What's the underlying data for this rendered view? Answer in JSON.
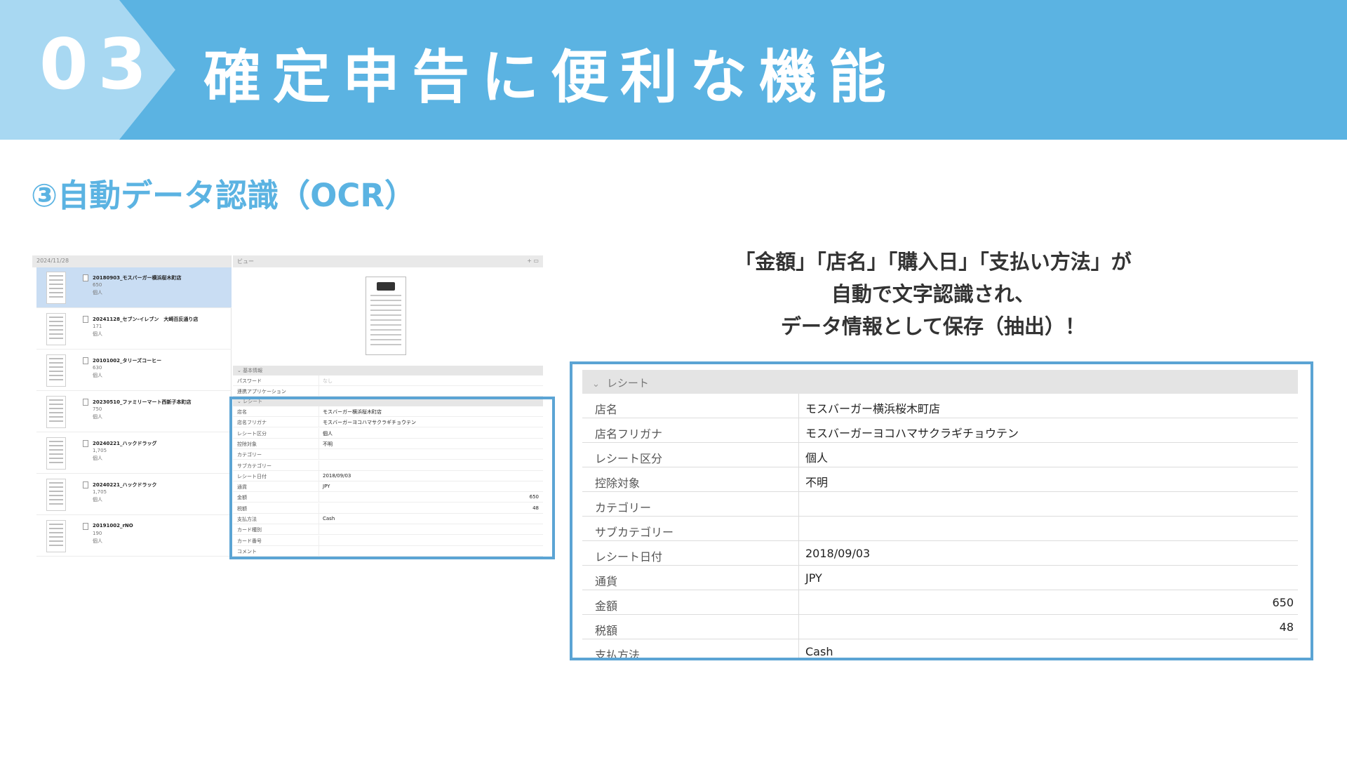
{
  "header": {
    "number": "03",
    "title": "確定申告に便利な機能",
    "colors": {
      "band": "#5bb3e2",
      "chevron": "#a8d8f2",
      "text": "#ffffff"
    }
  },
  "subtitle": "③自動データ認識（OCR）",
  "caption": {
    "lines": [
      "「金額」「店名」「購入日」「支払い方法」が",
      "自動で文字認識され、",
      "データ情報として保存（抽出）！"
    ]
  },
  "list": {
    "date_header": "2024/11/28",
    "items": [
      {
        "title": "20180903_モスバーガー横浜桜木町店",
        "amount": "650",
        "category": "個人",
        "selected": true
      },
      {
        "title": "20241128_セブン-イレブン　大崎百反通り店",
        "amount": "171",
        "category": "個人",
        "selected": false
      },
      {
        "title": "20101002_タリーズコーヒー",
        "amount": "630",
        "category": "個人",
        "selected": false
      },
      {
        "title": "20230510_ファミリーマート西新子本町店",
        "amount": "750",
        "category": "個人",
        "selected": false
      },
      {
        "title": "20240221_ハックドラッグ",
        "amount": "1,705",
        "category": "個人",
        "selected": false
      },
      {
        "title": "20240221_ハックドラック",
        "amount": "1,705",
        "category": "個人",
        "selected": false
      },
      {
        "title": "20191002_rNO",
        "amount": "190",
        "category": "個人",
        "selected": false
      }
    ]
  },
  "detail": {
    "view_label": "ビュー",
    "view_controls": "+ ▭",
    "basic_section": "基本情報",
    "basic_rows": [
      {
        "label": "パスワード",
        "value": "なし"
      },
      {
        "label": "連携アプリケーション",
        "value": ""
      }
    ],
    "receipt_section": "レシート",
    "extra_rows": [
      {
        "label": "カード種別",
        "value": ""
      },
      {
        "label": "カード番号",
        "value": ""
      },
      {
        "label": "コメント",
        "value": ""
      }
    ]
  },
  "receipt": {
    "section_label": "レシート",
    "rows": [
      {
        "label": "店名",
        "value": "モスバーガー横浜桜木町店",
        "numeric": false
      },
      {
        "label": "店名フリガナ",
        "value": "モスバーガーヨコハマサクラギチョウテン",
        "numeric": false
      },
      {
        "label": "レシート区分",
        "value": "個人",
        "numeric": false
      },
      {
        "label": "控除対象",
        "value": "不明",
        "numeric": false
      },
      {
        "label": "カテゴリー",
        "value": "",
        "numeric": false
      },
      {
        "label": "サブカテゴリー",
        "value": "",
        "numeric": false
      },
      {
        "label": "レシート日付",
        "value": "2018/09/03",
        "numeric": false
      },
      {
        "label": "通貨",
        "value": "JPY",
        "numeric": false
      },
      {
        "label": "金額",
        "value": "650",
        "numeric": true
      },
      {
        "label": "税額",
        "value": "48",
        "numeric": true
      },
      {
        "label": "支払方法",
        "value": "Cash",
        "numeric": false
      }
    ]
  }
}
